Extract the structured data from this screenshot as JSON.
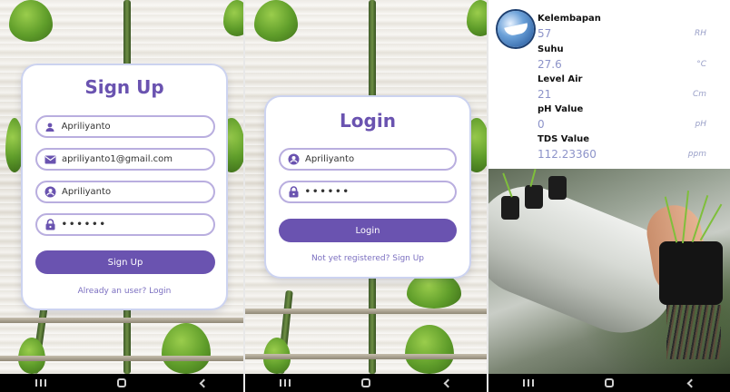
{
  "signup": {
    "title": "Sign Up",
    "name_value": "Apriliyanto",
    "email_value": "apriliyanto1@gmail.com",
    "username_value": "Apriliyanto",
    "password_value": "••••••",
    "button_label": "Sign Up",
    "footer_link": "Already an user? Login"
  },
  "login": {
    "title": "Login",
    "username_value": "Apriliyanto",
    "password_value": "••••••",
    "button_label": "Login",
    "footer_link": "Not yet registered? Sign Up"
  },
  "sensors": [
    {
      "label": "Kelembapan",
      "value": "57",
      "unit": "RH"
    },
    {
      "label": "Suhu",
      "value": "27.6",
      "unit": "°C"
    },
    {
      "label": "Level Air",
      "value": "21",
      "unit": "Cm"
    },
    {
      "label": "pH Value",
      "value": "0",
      "unit": "pH"
    },
    {
      "label": "TDS Value",
      "value": "112.23360",
      "unit": "ppm"
    }
  ],
  "colors": {
    "accent": "#6a53b0",
    "field_border": "#b9aedf",
    "value_text": "#8c93c9"
  },
  "icons": {
    "person": "person-icon",
    "mail": "mail-icon",
    "account_circle": "account-circle-icon",
    "lock": "lock-icon",
    "app_logo": "app-logo-icon",
    "nav_recent": "recent-apps-icon",
    "nav_home": "home-icon",
    "nav_back": "back-icon"
  }
}
